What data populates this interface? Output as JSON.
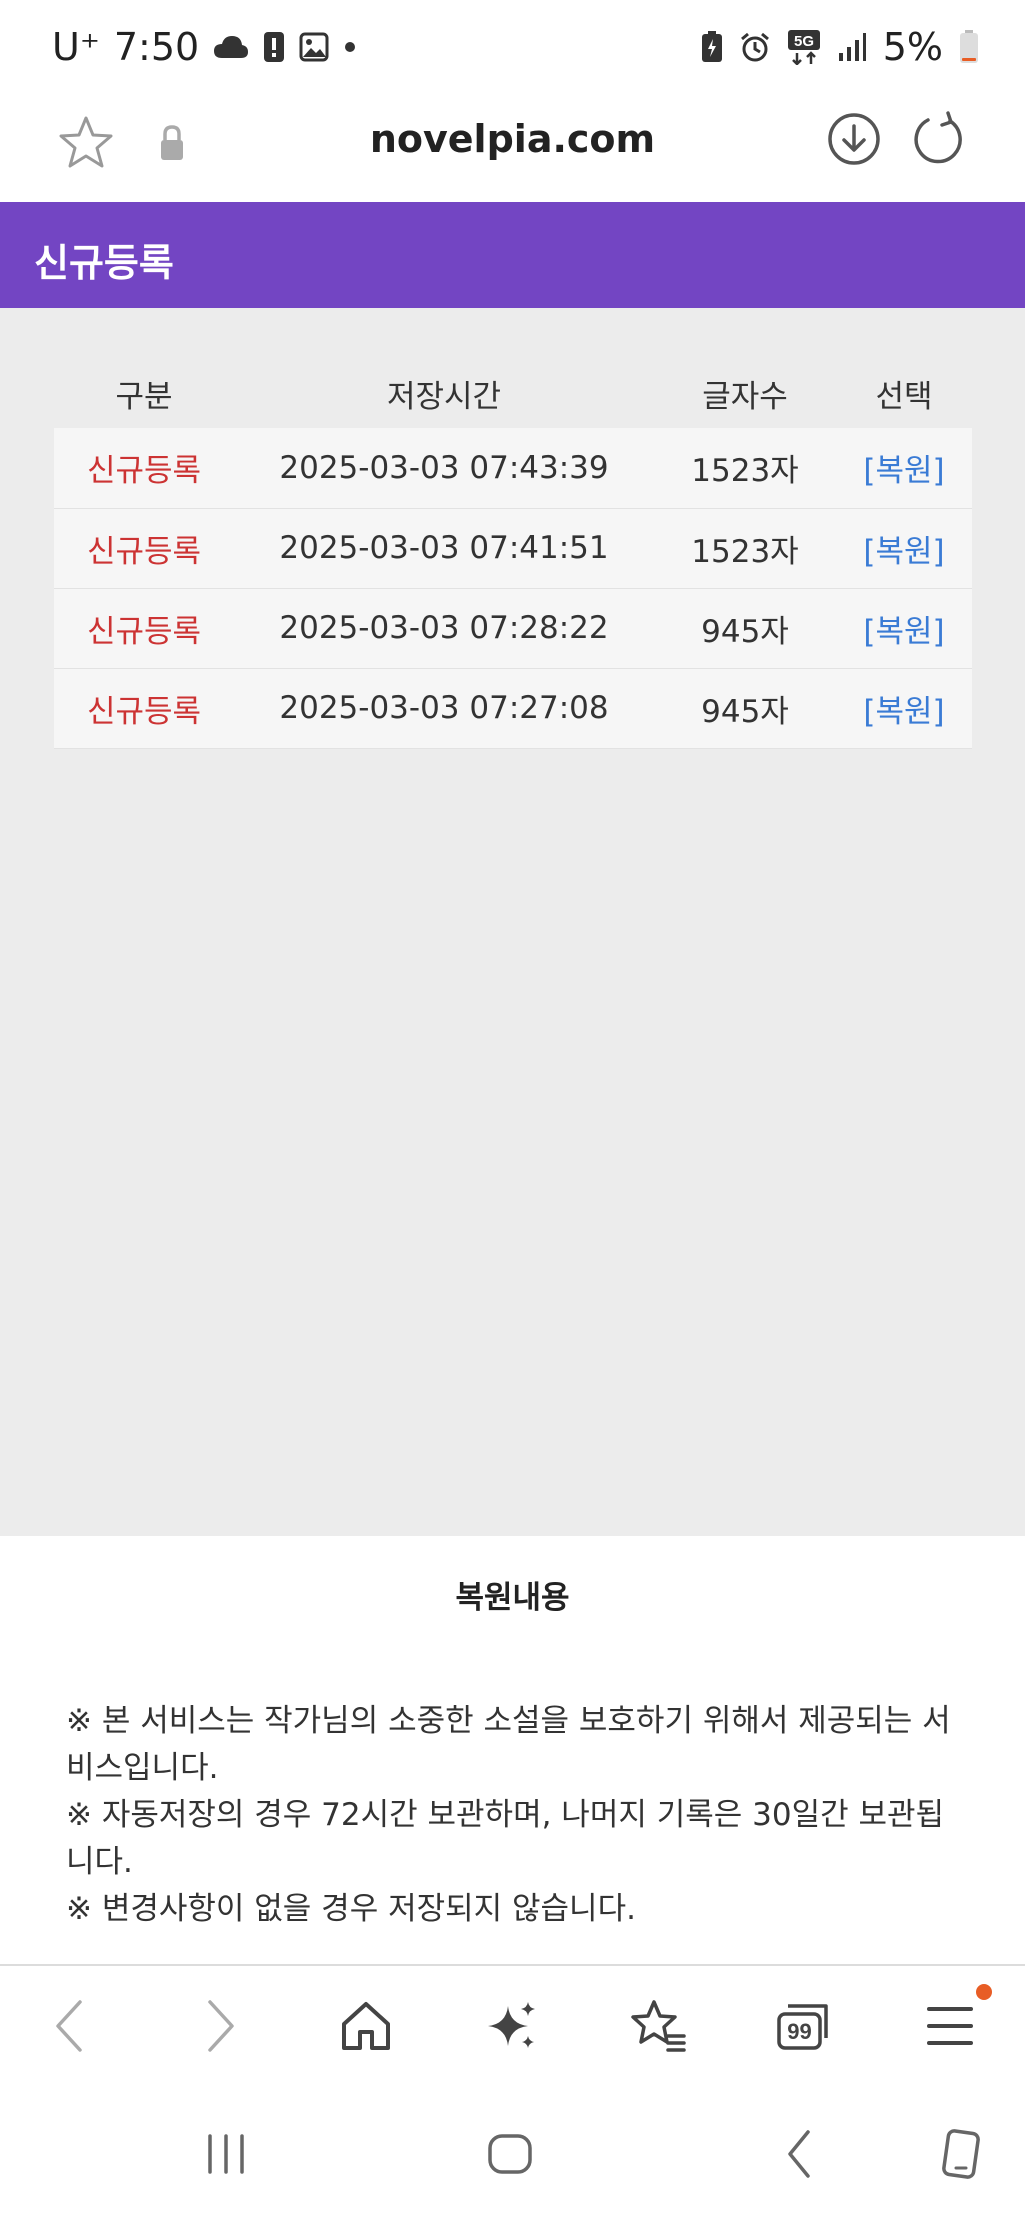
{
  "status_bar": {
    "carrier": "U⁺",
    "time": "7:50",
    "battery": "5%"
  },
  "address_bar": {
    "url": "novelpia.com"
  },
  "header": {
    "title": "신규등록"
  },
  "table": {
    "headers": [
      "구분",
      "저장시간",
      "글자수",
      "선택"
    ],
    "rows": [
      {
        "type": "신규등록",
        "time": "2025-03-03 07:43:39",
        "count": "1523자",
        "action": "[복원]"
      },
      {
        "type": "신규등록",
        "time": "2025-03-03 07:41:51",
        "count": "1523자",
        "action": "[복원]"
      },
      {
        "type": "신규등록",
        "time": "2025-03-03 07:28:22",
        "count": "945자",
        "action": "[복원]"
      },
      {
        "type": "신규등록",
        "time": "2025-03-03 07:27:08",
        "count": "945자",
        "action": "[복원]"
      }
    ]
  },
  "info": {
    "title": "복원내용",
    "lines": [
      "※ 본 서비스는 작가님의 소중한 소설을 보호하기 위해서 제공되는 서비스입니다.",
      "※ 자동저장의 경우 72시간 보관하며, 나머지 기록은 30일간 보관됩니다.",
      "※ 변경사항이 없을 경우 저장되지 않습니다."
    ]
  },
  "toolbar": {
    "tabs_count": "99"
  },
  "colors": {
    "header_bg": "#7345c3",
    "type_text": "#cc3333",
    "restore_link": "#3a7bd5",
    "notification_dot": "#e85d25"
  }
}
